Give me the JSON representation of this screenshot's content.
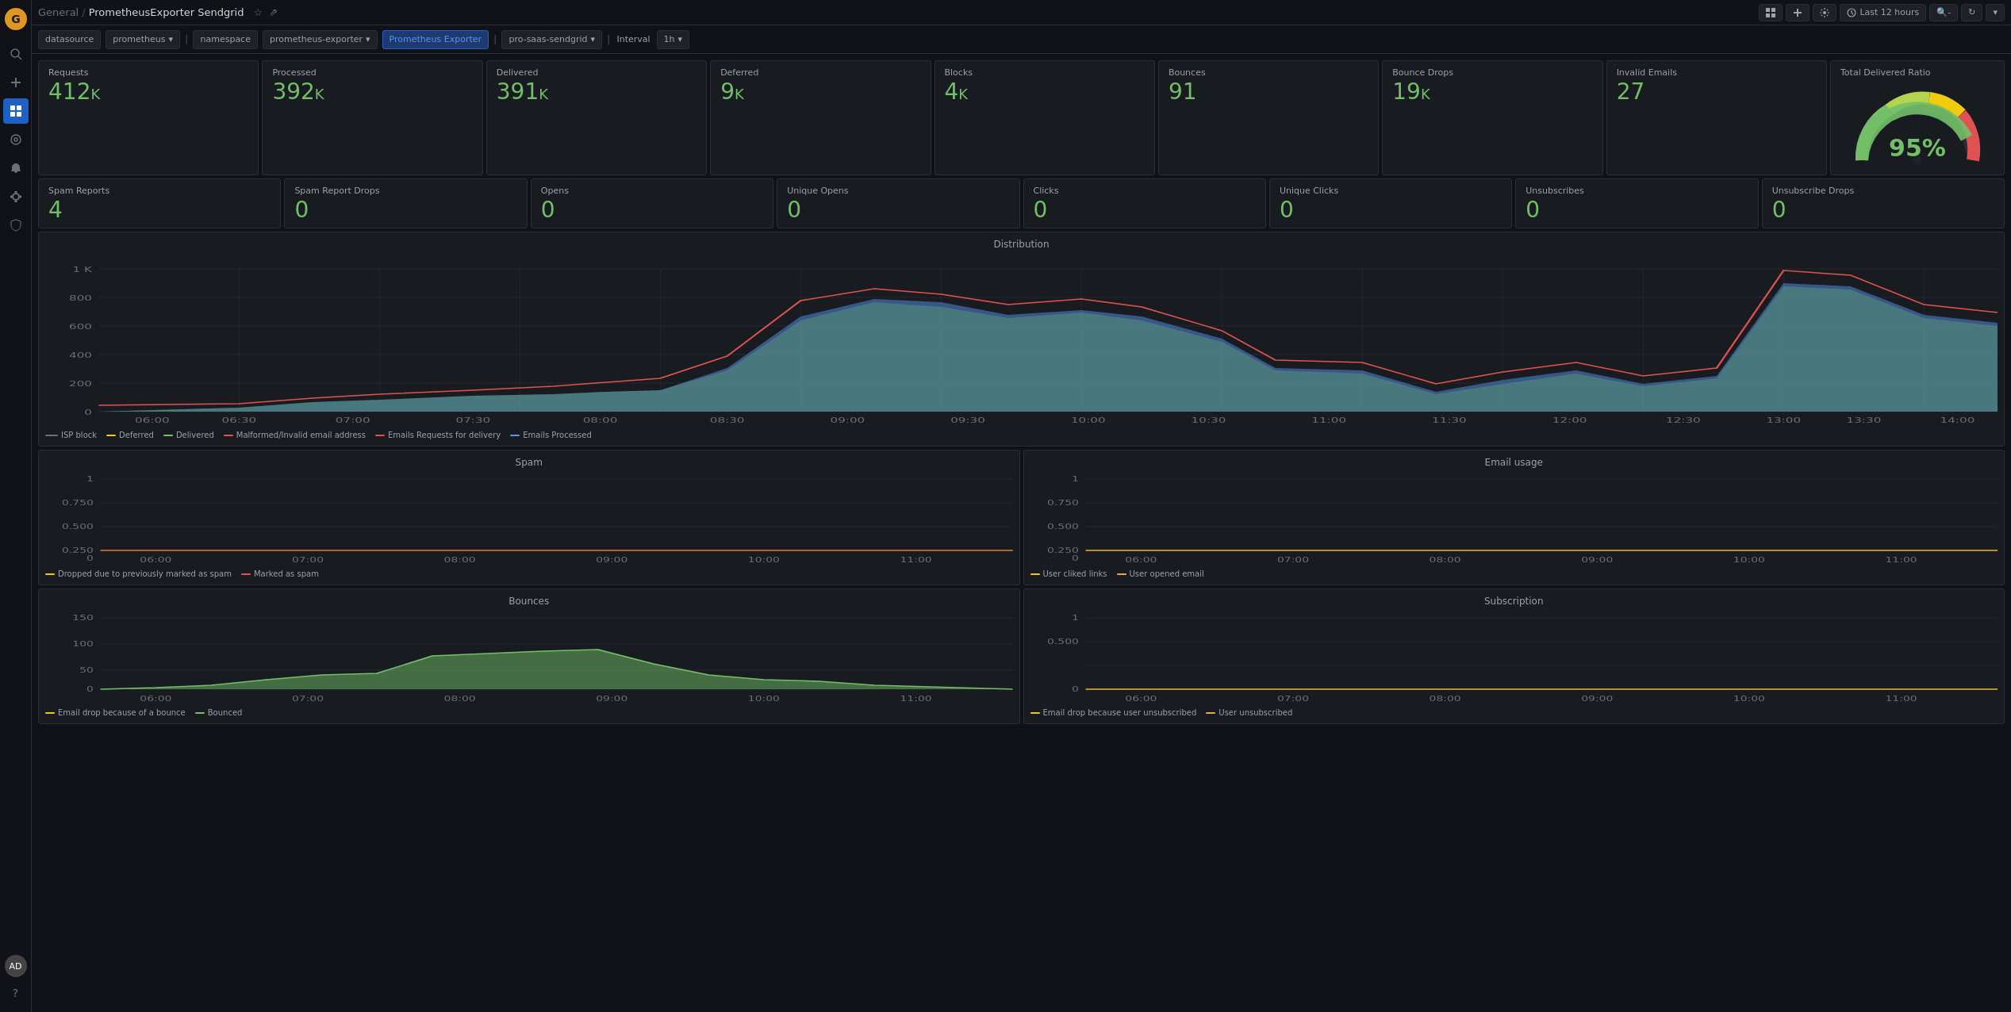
{
  "app": {
    "logo": "G",
    "title": "Grafana"
  },
  "breadcrumb": {
    "parent": "General",
    "separator": "/",
    "current": "PrometheusExporter Sendgrid"
  },
  "topbar": {
    "time_range": "Last 12 hours",
    "refresh": "↻",
    "add_panel": "+",
    "dashboard_settings": "⚙"
  },
  "filters": [
    {
      "id": "datasource",
      "label": "datasource",
      "value": ""
    },
    {
      "id": "prometheus",
      "label": "prometheus",
      "value": "▾"
    },
    {
      "id": "namespace-sep",
      "label": "|",
      "type": "sep"
    },
    {
      "id": "namespace",
      "label": "namespace",
      "value": ""
    },
    {
      "id": "prometheus-exporter",
      "label": "prometheus-exporter",
      "value": "▾"
    },
    {
      "id": "prometheus-exporter-2",
      "label": "Prometheus Exporter",
      "value": ""
    },
    {
      "id": "pro-saas-sep",
      "label": "",
      "type": "sep"
    },
    {
      "id": "pro-saas-sendgrid",
      "label": "pro-saas-sendgrid",
      "value": "▾"
    },
    {
      "id": "interval-sep",
      "label": "Interval",
      "type": "label"
    },
    {
      "id": "interval",
      "label": "1h",
      "value": "▾"
    }
  ],
  "stat_cards_row1": [
    {
      "id": "requests",
      "label": "Requests",
      "value": "412",
      "unit": "K",
      "color": "green"
    },
    {
      "id": "processed",
      "label": "Processed",
      "value": "392",
      "unit": "K",
      "color": "green"
    },
    {
      "id": "delivered",
      "label": "Delivered",
      "value": "391",
      "unit": "K",
      "color": "green"
    },
    {
      "id": "deferred",
      "label": "Deferred",
      "value": "9",
      "unit": "K",
      "color": "green"
    },
    {
      "id": "blocks",
      "label": "Blocks",
      "value": "4",
      "unit": "K",
      "color": "green"
    },
    {
      "id": "bounces",
      "label": "Bounces",
      "value": "91",
      "unit": "",
      "color": "green"
    },
    {
      "id": "bounce-drops",
      "label": "Bounce Drops",
      "value": "19",
      "unit": "K",
      "color": "green"
    },
    {
      "id": "invalid-emails",
      "label": "Invalid Emails",
      "value": "27",
      "unit": "",
      "color": "green"
    }
  ],
  "stat_cards_row2": [
    {
      "id": "spam-reports",
      "label": "Spam Reports",
      "value": "4",
      "unit": "",
      "color": "green"
    },
    {
      "id": "spam-report-drops",
      "label": "Spam Report Drops",
      "value": "0",
      "unit": "",
      "color": "green"
    },
    {
      "id": "opens",
      "label": "Opens",
      "value": "0",
      "unit": "",
      "color": "green"
    },
    {
      "id": "unique-opens",
      "label": "Unique Opens",
      "value": "0",
      "unit": "",
      "color": "green"
    },
    {
      "id": "clicks",
      "label": "Clicks",
      "value": "0",
      "unit": "",
      "color": "green"
    },
    {
      "id": "unique-clicks",
      "label": "Unique Clicks",
      "value": "0",
      "unit": "",
      "color": "green"
    },
    {
      "id": "unsubscribes",
      "label": "Unsubscribes",
      "value": "0",
      "unit": "",
      "color": "green"
    },
    {
      "id": "unsubscribe-drops",
      "label": "Unsubscribe Drops",
      "value": "0",
      "unit": "",
      "color": "green"
    }
  ],
  "gauge": {
    "label": "Total Delivered Ratio",
    "value": "95%",
    "percent": 95
  },
  "charts": {
    "distribution": {
      "title": "Distribution",
      "legend": [
        {
          "label": "ISP block",
          "color": "#6e7077",
          "style": "dashed"
        },
        {
          "label": "Deferred",
          "color": "#f2cc0c"
        },
        {
          "label": "Delivered",
          "color": "#73bf69"
        },
        {
          "label": "Malformed/Invalid email address",
          "color": "#e05252"
        },
        {
          "label": "Emails Requests for delivery",
          "color": "#e05252"
        },
        {
          "label": "Emails Processed",
          "color": "#5794f2"
        }
      ]
    },
    "spam": {
      "title": "Spam",
      "legend": [
        {
          "label": "Dropped due to previously marked as spam",
          "color": "#f2cc0c"
        },
        {
          "label": "Marked as spam",
          "color": "#e05252"
        }
      ]
    },
    "email_usage": {
      "title": "Email usage",
      "legend": [
        {
          "label": "User cliked links",
          "color": "#f2cc0c"
        },
        {
          "label": "User opened email",
          "color": "#e8aa44"
        }
      ]
    },
    "bounces": {
      "title": "Bounces",
      "legend": [
        {
          "label": "Email drop because of a bounce",
          "color": "#f2cc0c"
        },
        {
          "label": "Bounced",
          "color": "#73bf69"
        }
      ]
    },
    "subscription": {
      "title": "Subscription",
      "legend": [
        {
          "label": "Email drop because user unsubscribed",
          "color": "#f2cc0c"
        },
        {
          "label": "User unsubscribed",
          "color": "#e8aa44"
        }
      ]
    }
  },
  "sidebar_items": [
    {
      "id": "search",
      "icon": "🔍",
      "label": "Search"
    },
    {
      "id": "new",
      "icon": "+",
      "label": "New"
    },
    {
      "id": "dashboards",
      "icon": "⊞",
      "label": "Dashboards"
    },
    {
      "id": "explore",
      "icon": "◎",
      "label": "Explore"
    },
    {
      "id": "alerting",
      "icon": "🔔",
      "label": "Alerting"
    },
    {
      "id": "settings",
      "icon": "⚙",
      "label": "Settings"
    },
    {
      "id": "shield",
      "icon": "🛡",
      "label": "Shield"
    }
  ]
}
